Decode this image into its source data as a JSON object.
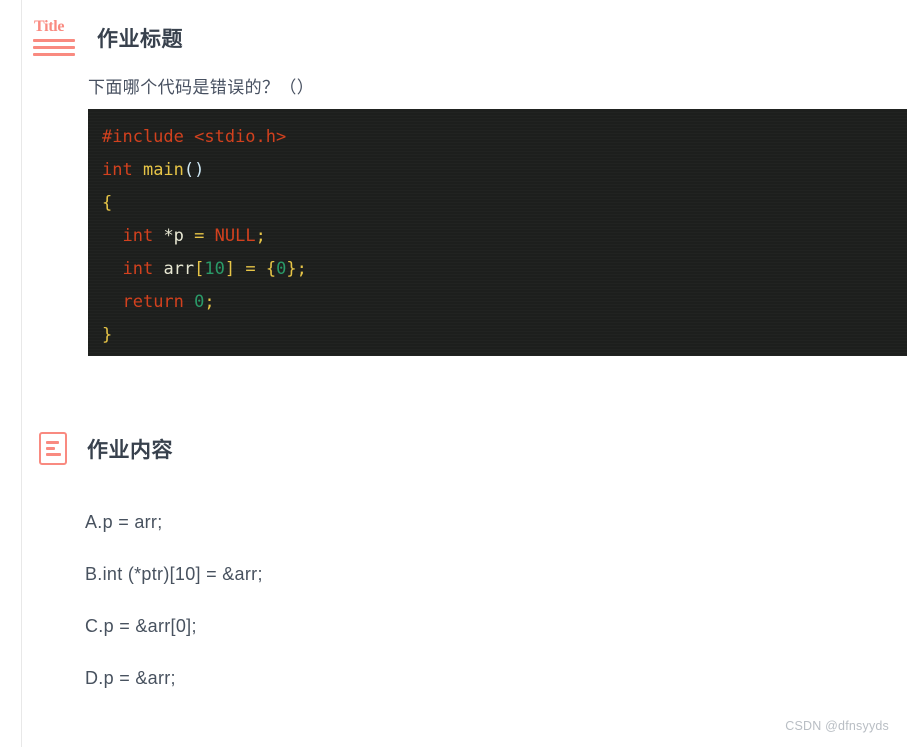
{
  "sections": {
    "title_section": {
      "icon": "title-icon",
      "heading": "作业标题",
      "question": "下面哪个代码是错误的？（）"
    },
    "content_section": {
      "icon": "document-lines-icon",
      "heading": "作业内容"
    }
  },
  "title_icon": {
    "word": "Title"
  },
  "code": {
    "language": "c",
    "lines": [
      [
        {
          "t": "#include ",
          "c": "kw"
        },
        {
          "t": "<stdio.h>",
          "c": "kw"
        }
      ],
      [
        {
          "t": "int ",
          "c": "kw"
        },
        {
          "t": "main",
          "c": "fn"
        },
        {
          "t": "()",
          "c": "paren"
        }
      ],
      [
        {
          "t": "{",
          "c": "pun"
        }
      ],
      [
        {
          "t": "  ",
          "c": "var"
        },
        {
          "t": "int ",
          "c": "kw"
        },
        {
          "t": "*p ",
          "c": "var"
        },
        {
          "t": "= ",
          "c": "pun"
        },
        {
          "t": "NULL",
          "c": "kw"
        },
        {
          "t": ";",
          "c": "pun"
        }
      ],
      [
        {
          "t": "  ",
          "c": "var"
        },
        {
          "t": "int ",
          "c": "kw"
        },
        {
          "t": "arr",
          "c": "var"
        },
        {
          "t": "[",
          "c": "pun"
        },
        {
          "t": "10",
          "c": "num"
        },
        {
          "t": "] ",
          "c": "pun"
        },
        {
          "t": "= ",
          "c": "pun"
        },
        {
          "t": "{",
          "c": "pun"
        },
        {
          "t": "0",
          "c": "num"
        },
        {
          "t": "};",
          "c": "pun"
        }
      ],
      [
        {
          "t": "  ",
          "c": "var"
        },
        {
          "t": "return ",
          "c": "kw"
        },
        {
          "t": "0",
          "c": "num"
        },
        {
          "t": ";",
          "c": "pun"
        }
      ],
      [
        {
          "t": "}",
          "c": "pun"
        }
      ]
    ]
  },
  "options": [
    "A.p = arr;",
    "B.int (*ptr)[10] = &arr;",
    "C.p = &arr[0];",
    "D.p = &arr;"
  ],
  "watermark": "CSDN @dfnsyyds",
  "colors": {
    "accent_salmon": "#f98a80",
    "heading": "#38414d",
    "body_text": "#48525f",
    "code_background": "#1d1f1d",
    "code_keyword": "#d2411e",
    "code_function": "#e7c547",
    "code_punctuation": "#e7c547",
    "code_number": "#2a9a68",
    "code_identifier": "#e8e8d3",
    "watermark": "#b9bec4",
    "page_background": "#ffffff"
  }
}
